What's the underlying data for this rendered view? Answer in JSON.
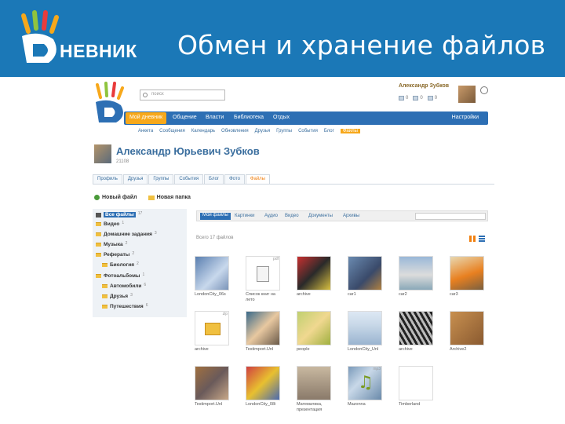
{
  "slide": {
    "logo_text": "НЕВНИК",
    "title": "Обмен и хранение файлов"
  },
  "header": {
    "search_placeholder": "поиск",
    "user_name": "Александр Зубков",
    "counters": [
      "0",
      "0",
      "0"
    ]
  },
  "nav": {
    "items": [
      "Мой дневник",
      "Общение",
      "Власти",
      "Библиотека",
      "Отдых"
    ],
    "settings": "Настройки"
  },
  "subnav": {
    "items": [
      "Анкета",
      "Сообщения",
      "Календарь",
      "Обновления",
      "Друзья",
      "Группы",
      "События",
      "Блог",
      "Файлы"
    ]
  },
  "profile": {
    "name": "Александр Юрьевич Зубков",
    "id": "21108",
    "tabs": [
      "Профиль",
      "Друзья",
      "Группы",
      "События",
      "Блог",
      "Фото",
      "Файлы"
    ]
  },
  "actions": {
    "new_file": "Новый файл",
    "new_folder": "Новая папка"
  },
  "tree": [
    {
      "label": "Все файлы",
      "count": "17"
    },
    {
      "label": "Видео",
      "count": "1"
    },
    {
      "label": "Домашние задания",
      "count": "3"
    },
    {
      "label": "Музыка",
      "count": "2"
    },
    {
      "label": "Рефераты",
      "count": "2"
    },
    {
      "label": "Биология",
      "count": "2"
    },
    {
      "label": "Фотоальбомы",
      "count": "1"
    },
    {
      "label": "Автомобили",
      "count": "6"
    },
    {
      "label": "Друзья",
      "count": "3"
    },
    {
      "label": "Путешествия",
      "count": "6"
    }
  ],
  "view_tabs": [
    "Мои файлы",
    "Картинки",
    "Аудио",
    "Видео",
    "Документы",
    "Архивы"
  ],
  "total_label": "Всего 17 файлов",
  "files": [
    {
      "name": "LondonCity_06s",
      "ext": ""
    },
    {
      "name": "Список книг на лето",
      "ext": "pdf"
    },
    {
      "name": "archive",
      "ext": ""
    },
    {
      "name": "car1",
      "ext": ""
    },
    {
      "name": "car2",
      "ext": ""
    },
    {
      "name": "car3",
      "ext": ""
    },
    {
      "name": "archive",
      "ext": "zip"
    },
    {
      "name": "Testimport.Unl",
      "ext": ""
    },
    {
      "name": "people",
      "ext": ""
    },
    {
      "name": "LondonCity_Unl",
      "ext": ""
    },
    {
      "name": "archive",
      "ext": ""
    },
    {
      "name": "Archive2",
      "ext": ""
    },
    {
      "name": "Testimport.Unl",
      "ext": ""
    },
    {
      "name": "LondonCity_08i",
      "ext": ""
    },
    {
      "name": "Математика, презентация",
      "ext": ""
    },
    {
      "name": "Mazonna",
      "ext": "mp3"
    },
    {
      "name": "Timberland",
      "ext": ""
    }
  ],
  "colors": {
    "banner": "#1b78b7",
    "nav": "#2d6fb4",
    "accent": "#f7a81b"
  }
}
